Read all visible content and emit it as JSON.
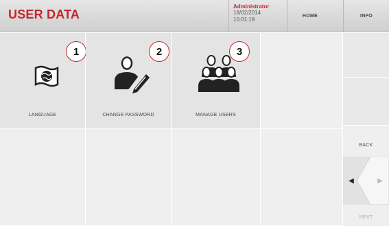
{
  "header": {
    "title": "USER DATA",
    "user_role": "Administrator",
    "date": "18/02/2014",
    "time": "10:01:19",
    "home_label": "HOME",
    "info_label": "INFO"
  },
  "tiles": [
    {
      "number": "1",
      "label": "LANGUAGE",
      "icon": "flag-globe-icon"
    },
    {
      "number": "2",
      "label": "CHANGE PASSWORD",
      "icon": "user-pencil-icon"
    },
    {
      "number": "3",
      "label": "MANAGE USERS",
      "icon": "users-group-icon"
    }
  ],
  "nav": {
    "back_label": "BACK",
    "next_label": "NEXT"
  },
  "colors": {
    "accent": "#c4262e",
    "tile_bg": "#efefef",
    "header_bg": "#dcdcdc"
  }
}
